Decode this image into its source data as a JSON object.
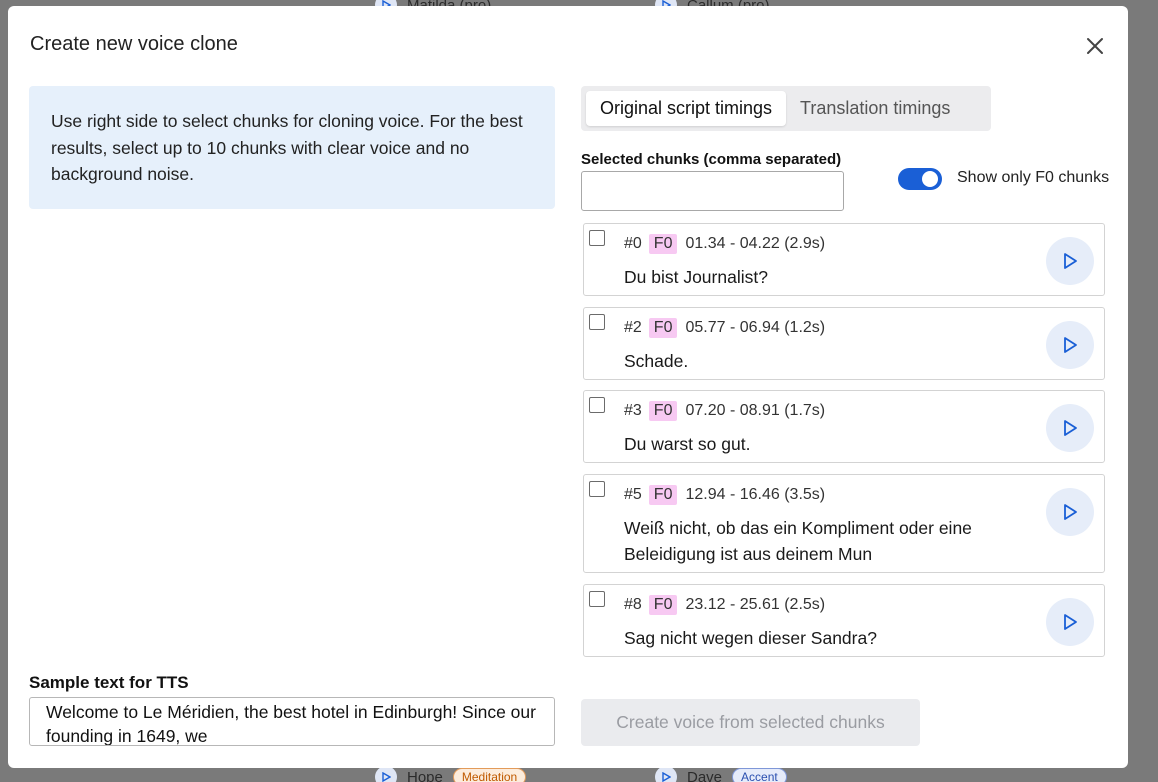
{
  "modal": {
    "title": "Create new voice clone",
    "close_icon": "close-icon"
  },
  "info": {
    "text": "Use right side to select chunks for cloning voice. For the best results, select up to 10 chunks with clear voice and no background noise."
  },
  "tabs": [
    {
      "label": "Original script timings",
      "active": true
    },
    {
      "label": "Translation timings",
      "active": false
    }
  ],
  "selected_chunks": {
    "label": "Selected chunks (comma separated)",
    "value": ""
  },
  "toggle": {
    "label": "Show only F0 chunks",
    "on": true
  },
  "chunks": [
    {
      "num": "#0",
      "tag": "F0",
      "timing": "01.34 - 04.22 (2.9s)",
      "text": "Du bist Journalist?"
    },
    {
      "num": "#2",
      "tag": "F0",
      "timing": "05.77 - 06.94 (1.2s)",
      "text": "Schade."
    },
    {
      "num": "#3",
      "tag": "F0",
      "timing": "07.20 - 08.91 (1.7s)",
      "text": "Du warst so gut."
    },
    {
      "num": "#5",
      "tag": "F0",
      "timing": "12.94 - 16.46 (3.5s)",
      "text": "Weiß nicht, ob das ein Kompliment oder eine Beleidigung ist aus deinem Mun"
    },
    {
      "num": "#8",
      "tag": "F0",
      "timing": "23.12 - 25.61 (2.5s)",
      "text": "Sag nicht wegen dieser Sandra?"
    }
  ],
  "tts": {
    "label": "Sample text for TTS",
    "value": "Welcome to Le Méridien, the best hotel in Edinburgh! Since our founding in 1649, we"
  },
  "create_button": {
    "label": "Create voice from selected chunks",
    "disabled": true
  },
  "background": {
    "top_items": [
      "Matilda (pro)",
      "Callum (pro)"
    ],
    "bottom_items": [
      {
        "name": "Hope",
        "badge": "Meditation"
      },
      {
        "name": "Dave",
        "badge": "Accent"
      }
    ]
  },
  "colors": {
    "accent": "#1a5fd6",
    "info_bg": "#e6f0fb",
    "tag_bg": "#f7c9f2",
    "overlay": "#7a7a7a"
  }
}
